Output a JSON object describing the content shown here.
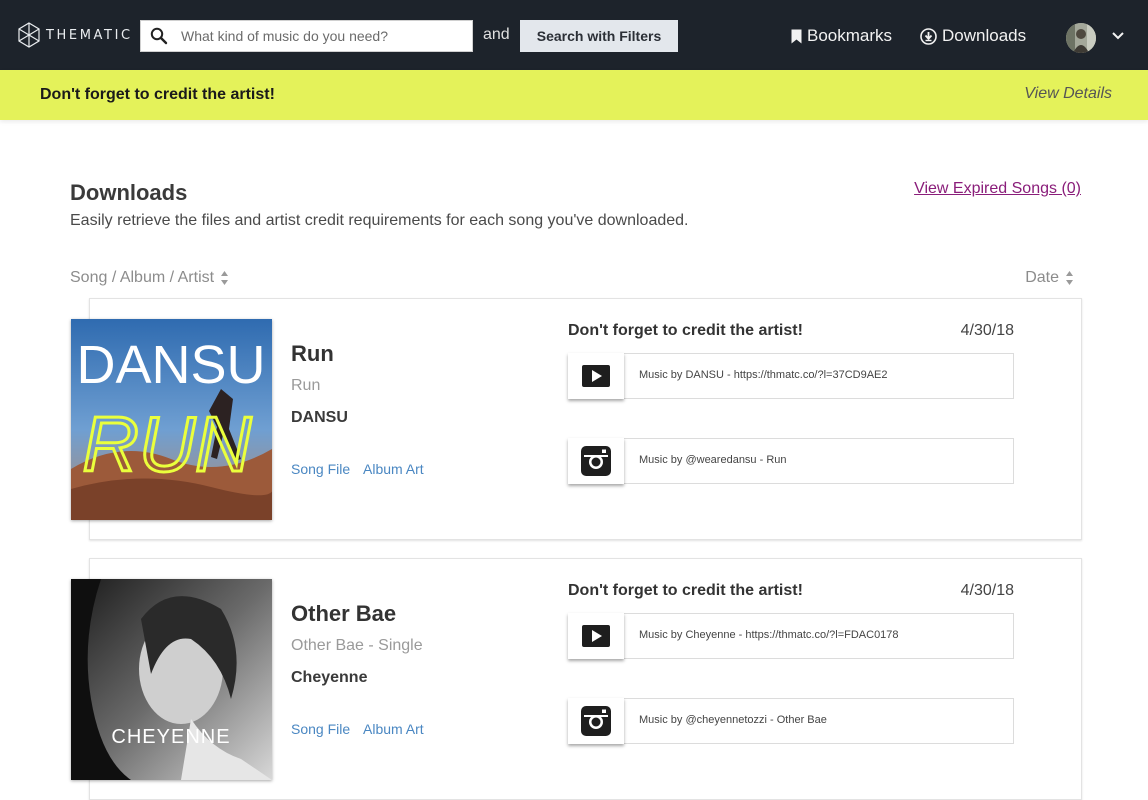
{
  "nav": {
    "logo_text": "THEMATIC",
    "search_placeholder": "What kind of music do you need?",
    "and_label": "and",
    "filter_button": "Search with Filters",
    "bookmarks_label": "Bookmarks",
    "downloads_label": "Downloads"
  },
  "banner": {
    "text": "Don't forget to credit the artist!",
    "link": "View Details"
  },
  "page": {
    "title": "Downloads",
    "subtitle": "Easily retrieve the files and artist credit requirements for each song you've downloaded.",
    "expired_link": "View Expired Songs (0)",
    "sort_song": "Song / Album / Artist",
    "sort_date": "Date"
  },
  "downloads": [
    {
      "art_text_top": "DANSU",
      "art_text_bottom": "RUN",
      "song": "Run",
      "album": "Run",
      "artist": "DANSU",
      "song_file_link": "Song File",
      "album_art_link": "Album Art",
      "credit_heading": "Don't forget to credit the artist!",
      "date": "4/30/18",
      "credits": [
        {
          "icon": "youtube-play-icon",
          "text": "Music by DANSU - https://thmatc.co/?l=37CD9AE2"
        },
        {
          "icon": "instagram-icon",
          "text": "Music by @wearedansu - Run"
        }
      ]
    },
    {
      "art_text": "CHEYENNE",
      "song": "Other Bae",
      "album": "Other Bae - Single",
      "artist": "Cheyenne",
      "song_file_link": "Song File",
      "album_art_link": "Album Art",
      "credit_heading": "Don't forget to credit the artist!",
      "date": "4/30/18",
      "credits": [
        {
          "icon": "youtube-play-icon",
          "text": "Music by Cheyenne - https://thmatc.co/?l=FDAC0178"
        },
        {
          "icon": "instagram-icon",
          "text": "Music by @cheyennetozzi - Other Bae"
        }
      ]
    }
  ],
  "colors": {
    "topbar": "#1d232b",
    "banner": "#e4f25a",
    "link_blue": "#4a87c2",
    "expired_link": "#8a1d7a"
  }
}
